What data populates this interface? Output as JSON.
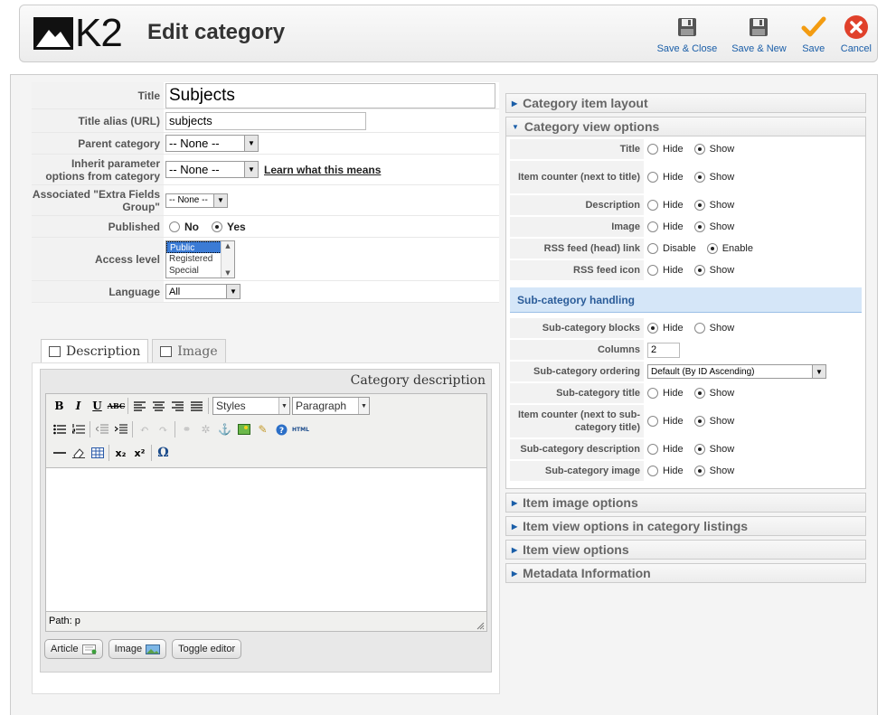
{
  "header": {
    "brand": "K2",
    "title": "Edit category",
    "toolbar": [
      {
        "label": "Save & Close",
        "icon": "save-icon"
      },
      {
        "label": "Save & New",
        "icon": "save-icon"
      },
      {
        "label": "Save",
        "icon": "checkmark-icon"
      },
      {
        "label": "Cancel",
        "icon": "cancel-icon"
      }
    ]
  },
  "form": {
    "title_label": "Title",
    "title_value": "Subjects",
    "alias_label": "Title alias (URL)",
    "alias_value": "subjects",
    "parent_label": "Parent category",
    "parent_value": "-- None --",
    "inherit_label": "Inherit parameter options from category",
    "inherit_value": "-- None --",
    "inherit_link": "Learn what this means",
    "extra_label": "Associated \"Extra Fields Group\"",
    "extra_value": "-- None --",
    "published_label": "Published",
    "published_no": "No",
    "published_yes": "Yes",
    "access_label": "Access level",
    "access_options": [
      "Public",
      "Registered",
      "Special"
    ],
    "language_label": "Language",
    "language_value": "All"
  },
  "tabs": {
    "description": "Description",
    "image": "Image"
  },
  "editor": {
    "heading": "Category description",
    "styles": "Styles",
    "format": "Paragraph",
    "path": "Path: p",
    "buttons": {
      "bold": "B",
      "italic": "I",
      "underline": "U",
      "strike": "ABC",
      "html": "HTML",
      "sub": "x₂",
      "sup": "x²",
      "omega": "Ω"
    },
    "article_btn": "Article",
    "image_btn": "Image",
    "toggle_btn": "Toggle editor"
  },
  "panes": {
    "item_layout": "Category item layout",
    "view_options": "Category view options",
    "item_image": "Item image options",
    "item_view_listings": "Item view options in category listings",
    "item_view": "Item view options",
    "metadata": "Metadata Information"
  },
  "view_options": {
    "hide": "Hide",
    "show": "Show",
    "disable": "Disable",
    "enable": "Enable",
    "title": "Title",
    "item_counter": "Item counter (next to title)",
    "description": "Description",
    "image": "Image",
    "rss_link": "RSS feed (head) link",
    "rss_icon": "RSS feed icon"
  },
  "subcategory": {
    "heading": "Sub-category handling",
    "blocks": "Sub-category blocks",
    "columns": "Columns",
    "columns_value": "2",
    "ordering": "Sub-category ordering",
    "ordering_value": "Default (By ID Ascending)",
    "title": "Sub-category title",
    "item_counter": "Item counter (next to sub-category title)",
    "description": "Sub-category description",
    "image": "Sub-category image"
  }
}
